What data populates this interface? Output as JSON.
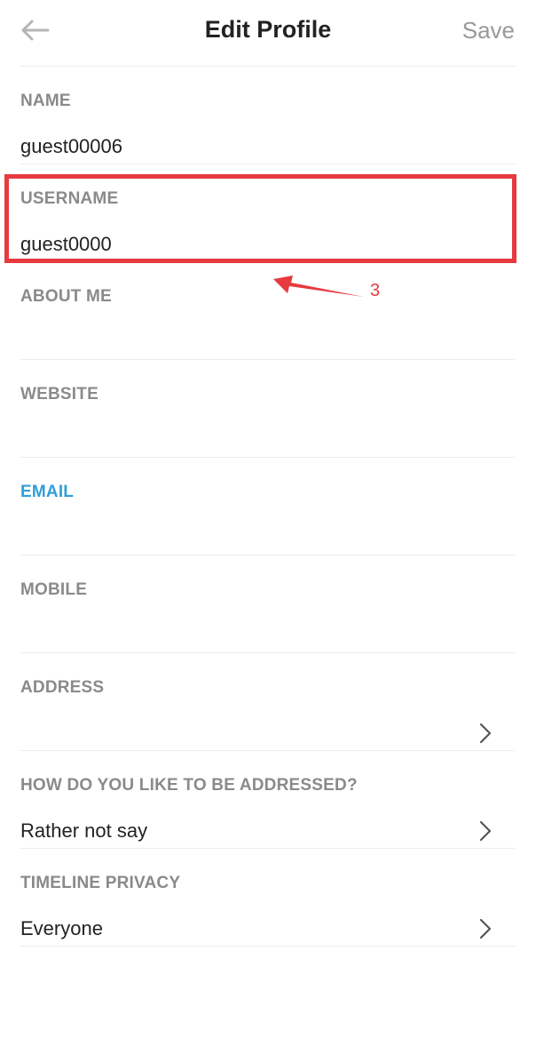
{
  "header": {
    "back_icon": "arrow-left-icon",
    "title": "Edit Profile",
    "save_label": "Save"
  },
  "fields": [
    {
      "label": "NAME",
      "value": "guest00006"
    },
    {
      "label": "USERNAME",
      "value": "guest0000"
    },
    {
      "label": "ABOUT ME",
      "value": ""
    },
    {
      "label": "WEBSITE",
      "value": ""
    },
    {
      "label": "EMAIL",
      "value": "",
      "active": true
    },
    {
      "label": "MOBILE",
      "value": ""
    },
    {
      "label": "ADDRESS",
      "value": "",
      "chevron": true
    },
    {
      "label": "HOW DO YOU LIKE TO BE ADDRESSED?",
      "value": "Rather not say",
      "chevron": true
    },
    {
      "label": "TIMELINE PRIVACY",
      "value": "Everyone",
      "chevron": true
    }
  ],
  "annotation": {
    "number": "3",
    "color": "#e63a3f"
  },
  "colors": {
    "accent": "#2f9fd8",
    "label": "#8a8a8a",
    "text": "#222222"
  }
}
